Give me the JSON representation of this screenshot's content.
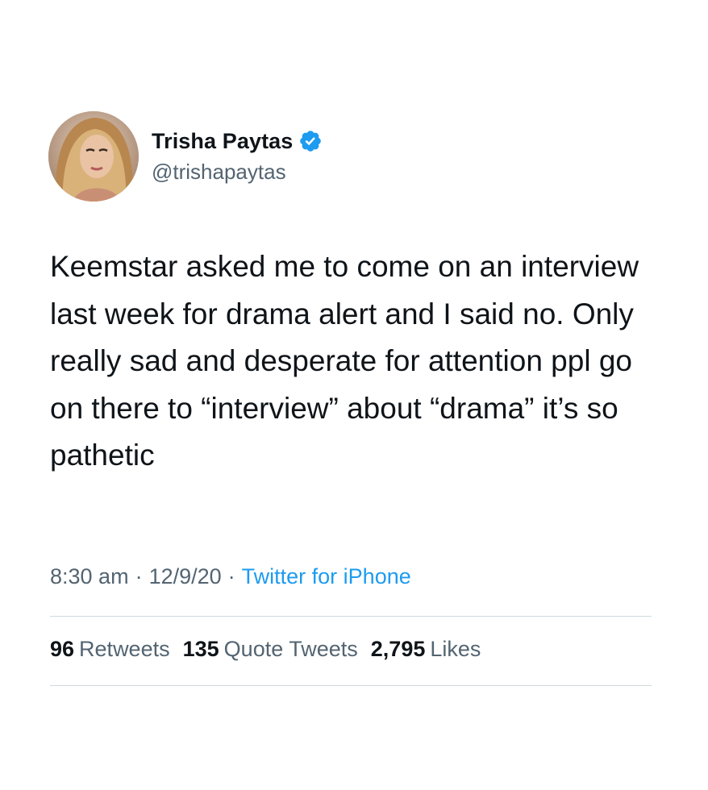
{
  "author": {
    "display_name": "Trisha Paytas",
    "handle": "@trishapaytas",
    "verified": true,
    "avatar": "profile-photo"
  },
  "tweet": {
    "text": "Keemstar asked me to come on an interview last week for drama alert and I said no. Only really sad and desperate for attention ppl go on there to “interview” about “drama” it’s so pathetic"
  },
  "meta": {
    "time": "8:30 am",
    "date": "12/9/20",
    "separator": "·",
    "source": "Twitter for iPhone"
  },
  "stats": {
    "retweets_count": "96",
    "retweets_label": "Retweets",
    "quotes_count": "135",
    "quotes_label": "Quote Tweets",
    "likes_count": "2,795",
    "likes_label": "Likes"
  },
  "colors": {
    "text": "#0f1419",
    "secondary": "#536471",
    "accent": "#1d9bf0",
    "divider": "#cfd9de"
  }
}
